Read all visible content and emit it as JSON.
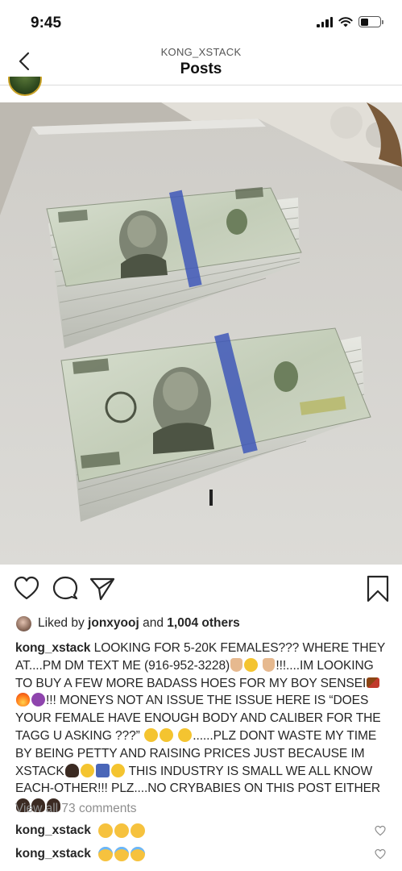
{
  "status_bar": {
    "time": "9:45"
  },
  "header": {
    "username": "KONG_XSTACK",
    "title": "Posts"
  },
  "post": {
    "likes": {
      "prefix": "Liked by",
      "user": "jonxyooj",
      "conjunction": "and",
      "count": "1,004 others"
    },
    "caption": {
      "username": "kong_xstack",
      "seg1": "LOOKING FOR 5-20K FEMALES??? WHERE THEY AT....PM DM TEXT ME (916-952-3228)",
      "seg2": "!!!....IM LOOKING TO BUY A FEW MORE BADASS HOES FOR MY BOY SENSEI",
      "seg3": "!!! MONEYS NOT AN ISSUE THE ISSUE HERE IS “DOES YOUR FEMALE HAVE ENOUGH BODY AND CALIBER FOR THE TAGG U ASKING ???”",
      "seg4": "......PLZ DONT WASTE MY TIME BY BEING PETTY AND RAISING PRICES JUST BECAUSE IM XSTACK",
      "seg5": "THIS INDUSTRY IS SMALL WE ALL KNOW EACH-OTHER!!! PLZ....NO CRYBABIES ON THIS POST EITHER"
    },
    "view_comments": "View all 73 comments",
    "comments": [
      {
        "username": "kong_xstack",
        "emoji": "squint-laugh-emoji"
      },
      {
        "username": "kong_xstack",
        "emoji": "halo-smile-emoji"
      }
    ]
  },
  "icons": [
    "back-chevron-icon",
    "heart-icon",
    "comment-icon",
    "share-icon",
    "bookmark-icon"
  ],
  "colors": {
    "text": "#262626",
    "muted": "#8e8e8e",
    "divider": "#dbdbdb",
    "bill_green": "#c9d4bf",
    "table": "#d7d6d2"
  }
}
